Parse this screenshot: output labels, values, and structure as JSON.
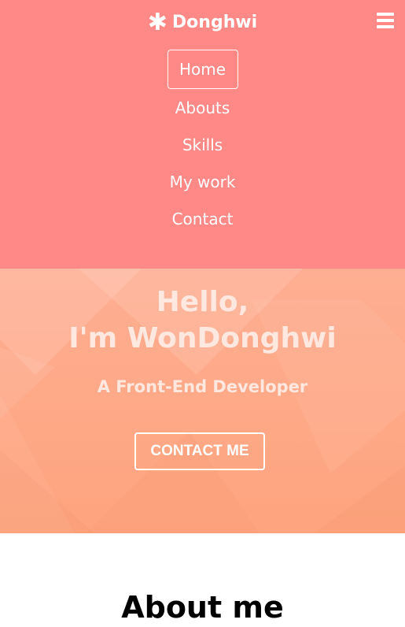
{
  "navbar": {
    "brand": "Donghwi",
    "brand_icon": "asterisk-icon",
    "menu_icon": "hamburger-icon",
    "items": [
      {
        "label": "Home"
      },
      {
        "label": "Abouts"
      },
      {
        "label": "Skills"
      },
      {
        "label": "My work"
      },
      {
        "label": "Contact"
      }
    ]
  },
  "hero": {
    "title_line1": "Hello,",
    "title_line2": "I'm WonDonghwi",
    "subtitle": "A Front-End Developer",
    "contact_button": "CONTACT ME"
  },
  "about": {
    "title": "About me"
  },
  "colors": {
    "navbar": "#fe8986",
    "hero": "#fea47e",
    "text": "#ffffff"
  }
}
